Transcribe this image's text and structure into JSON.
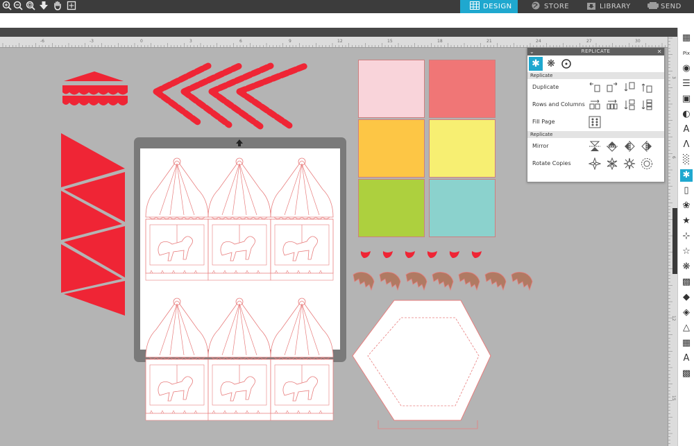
{
  "toolbar": {
    "icons": [
      "zoom-in-icon",
      "zoom-out-icon",
      "zoom-fit-icon",
      "move-down-icon",
      "pan-hand-icon",
      "fit-page-icon"
    ]
  },
  "nav": {
    "tabs": [
      {
        "name": "design",
        "label": "DESIGN",
        "active": true
      },
      {
        "name": "store",
        "label": "STORE",
        "active": false
      },
      {
        "name": "library",
        "label": "LIBRARY",
        "active": false
      },
      {
        "name": "send",
        "label": "SEND",
        "active": false
      }
    ]
  },
  "ruler": {
    "labels": [
      "-6",
      "-3",
      "0",
      "3",
      "6",
      "9",
      "12",
      "15",
      "18",
      "21",
      "24",
      "27",
      "30"
    ]
  },
  "vruler": {
    "labels": [
      "3",
      "6",
      "9",
      "12",
      "15"
    ]
  },
  "panel": {
    "title": "REPLICATE",
    "section1": "Replicate",
    "section2": "Replicate",
    "rows": {
      "duplicate": "Duplicate",
      "rows_columns": "Rows and Columns",
      "fill_page": "Fill Page",
      "mirror": "Mirror",
      "rotate_copies": "Rotate Copies"
    }
  },
  "swatches": [
    "#f9d4da",
    "#f07676",
    "#fdc645",
    "#f7ef72",
    "#add03e",
    "#8bd2cd"
  ],
  "colors": {
    "accent": "#1fa8cf",
    "shape_red": "#ef2535",
    "cut_line": "#e87d7d",
    "horse_brown": "#b07a63"
  },
  "right_toolbar": {
    "icons": [
      "page-setup-icon",
      "pixscan-icon",
      "fill-icon",
      "line-style-icon",
      "layers-icon",
      "transparency-icon",
      "text-style-icon",
      "text-path-icon",
      "align-icon",
      "replicate-icon",
      "modify-icon",
      "offset-icon",
      "trace-icon",
      "point-edit-icon",
      "star-shape-icon",
      "design-ideas-icon",
      "library-icon",
      "sketch-icon",
      "cube-icon",
      "fold-icon",
      "grid-panel-icon",
      "text-effects-icon",
      "pattern-icon"
    ],
    "active_index": 9
  }
}
